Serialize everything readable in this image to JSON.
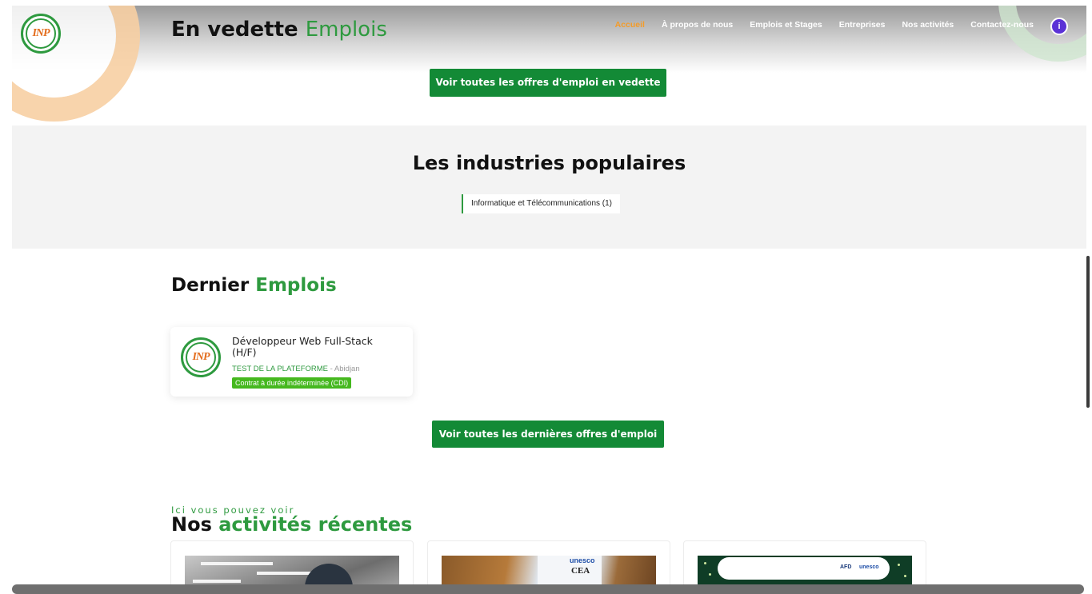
{
  "header": {
    "featured_title_strong": "En vedette",
    "featured_title_light": "Emplois",
    "nav": [
      {
        "label": "Accueil",
        "active": true
      },
      {
        "label": "À propos de nous",
        "active": false
      },
      {
        "label": "Emplois et Stages",
        "active": false
      },
      {
        "label": "Entreprises",
        "active": false
      },
      {
        "label": "Nos activités",
        "active": false
      },
      {
        "label": "Contactez-nous",
        "active": false
      }
    ],
    "badge": "i",
    "featured_button": "Voir toutes les offres d'emploi en vedette"
  },
  "industries": {
    "title": "Les industries populaires",
    "chips": [
      "Informatique et Télécommunications (1)"
    ]
  },
  "latest": {
    "title_strong": "Dernier",
    "title_light": "Emplois",
    "jobs": [
      {
        "title": "Développeur Web Full-Stack (H/F)",
        "company": "TEST DE LA PLATEFORME",
        "location": "- Abidjan",
        "type": "Contrat à durée indéterminée (CDI)"
      }
    ],
    "button": "Voir toutes les dernières offres d'emploi"
  },
  "activities": {
    "kicker": "Ici vous pouvez voir",
    "title_strong": "Nos",
    "title_light": "activités récentes",
    "image2_labels": [
      "unesco",
      "CEA"
    ],
    "image3_labels": [
      "AFD",
      "unesco"
    ]
  },
  "colors": {
    "brand_green": "#138a36",
    "accent_green": "#2e9a3f",
    "accent_orange": "#f39c2a",
    "badge_purple": "#5b32d6"
  },
  "logo": {
    "text": "INP"
  }
}
